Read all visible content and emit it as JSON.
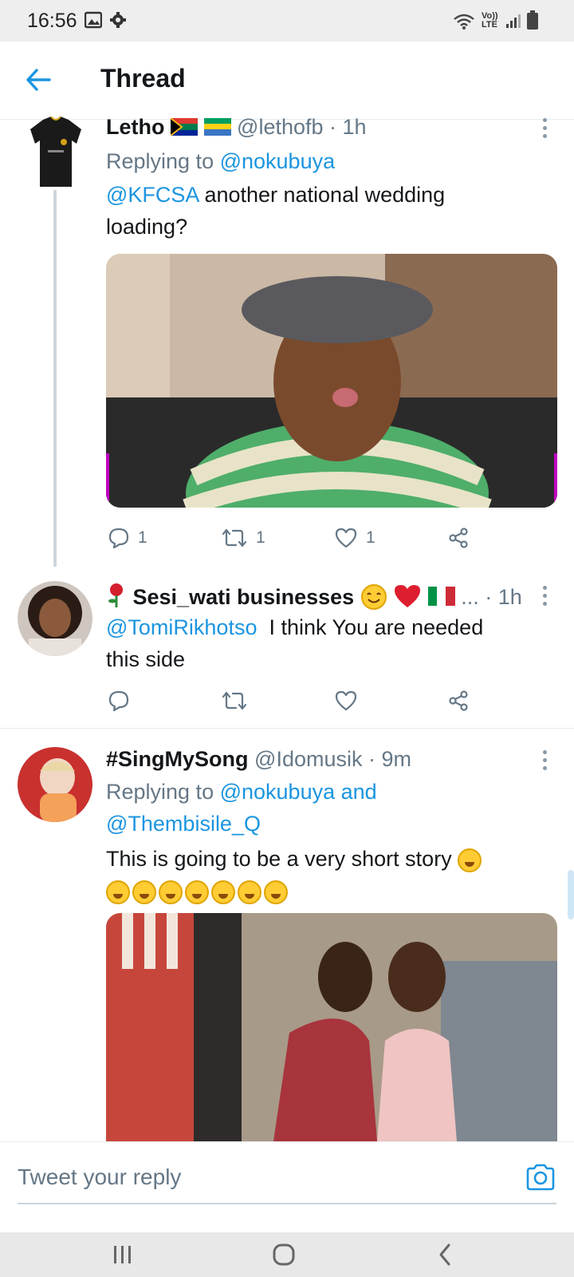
{
  "status_bar": {
    "time": "16:56",
    "network": "Vo)) LTE"
  },
  "header": {
    "title": "Thread"
  },
  "tweets": [
    {
      "name": "Letho",
      "handle": "@lethofb",
      "time": "· 1h",
      "replying_prefix": "Replying to ",
      "replying_to": "@nokubuya",
      "mention": "@KFCSA",
      "text_line1": " another national wedding",
      "text_line2": "loading?",
      "reply_count": "1",
      "retweet_count": "1",
      "like_count": "1"
    },
    {
      "name": "Sesi_wati businesses",
      "handle": "...",
      "time": "· 1h",
      "mention": "@TomiRikhotso",
      "text_line1": "  I think You are needed",
      "text_line2": "this side",
      "reply_count": "",
      "retweet_count": "",
      "like_count": ""
    },
    {
      "name": "#SingMySong",
      "handle": "@Idomusik",
      "time": "· 9m",
      "replying_prefix": "Replying to ",
      "replying_to": "@nokubuya and",
      "replying_to_2": "@Thembisile_Q",
      "text_line1": "This is going to be a very short story"
    }
  ],
  "reply_bar": {
    "placeholder": "Tweet your reply"
  },
  "colors": {
    "accent": "#1b95e0",
    "text": "#14171a",
    "muted": "#657786"
  },
  "icons": {
    "back": "arrow-left-icon",
    "more": "more-vertical-icon",
    "reply": "reply-icon",
    "retweet": "retweet-icon",
    "like": "heart-icon",
    "share": "share-icon",
    "camera": "camera-icon"
  }
}
